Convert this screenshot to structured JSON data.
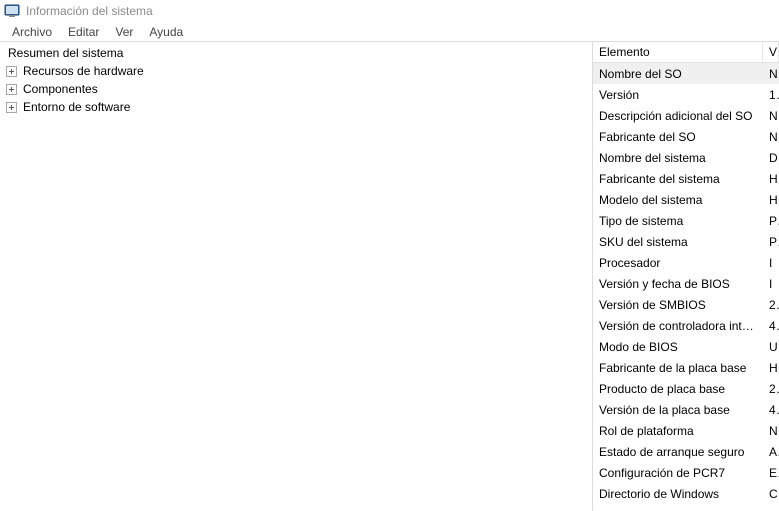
{
  "window": {
    "title": "Información del sistema"
  },
  "menu": {
    "items": [
      "Archivo",
      "Editar",
      "Ver",
      "Ayuda"
    ]
  },
  "tree": {
    "root": "Resumen del sistema",
    "children": [
      "Recursos de hardware",
      "Componentes",
      "Entorno de software"
    ]
  },
  "details": {
    "columns": {
      "element": "Elemento",
      "value": "V"
    },
    "selected_index": 0,
    "rows": [
      {
        "element": "Nombre del SO",
        "value": "N"
      },
      {
        "element": "Versión",
        "value": "1"
      },
      {
        "element": "Descripción adicional del SO",
        "value": "N"
      },
      {
        "element": "Fabricante del SO",
        "value": "N"
      },
      {
        "element": "Nombre del sistema",
        "value": "D"
      },
      {
        "element": "Fabricante del sistema",
        "value": "H"
      },
      {
        "element": "Modelo del sistema",
        "value": "H"
      },
      {
        "element": "Tipo de sistema",
        "value": "P"
      },
      {
        "element": "SKU del sistema",
        "value": "P"
      },
      {
        "element": "Procesador",
        "value": "I"
      },
      {
        "element": "Versión y fecha de BIOS",
        "value": "I"
      },
      {
        "element": "Versión de SMBIOS",
        "value": "2"
      },
      {
        "element": "Versión de controladora integr...",
        "value": "4"
      },
      {
        "element": "Modo de BIOS",
        "value": "U"
      },
      {
        "element": "Fabricante de la placa base",
        "value": "H"
      },
      {
        "element": "Producto de placa base",
        "value": "2"
      },
      {
        "element": "Versión de la placa base",
        "value": "4"
      },
      {
        "element": "Rol de plataforma",
        "value": "N"
      },
      {
        "element": "Estado de arranque seguro",
        "value": "A"
      },
      {
        "element": "Configuración de PCR7",
        "value": "E"
      },
      {
        "element": "Directorio de Windows",
        "value": "C"
      }
    ]
  }
}
